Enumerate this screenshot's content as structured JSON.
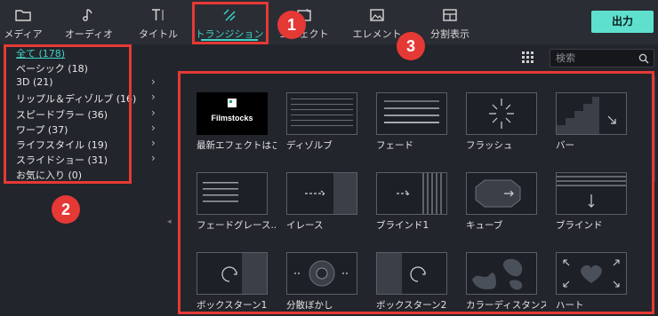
{
  "toolbar": {
    "tabs": [
      {
        "label": "メディア",
        "icon": "folder-icon"
      },
      {
        "label": "オーディオ",
        "icon": "music-note-icon"
      },
      {
        "label": "タイトル",
        "icon": "title-text-icon"
      },
      {
        "label": "トランジション",
        "icon": "transition-icon",
        "active": true
      },
      {
        "label": "エフェクト",
        "icon": "effects-icon"
      },
      {
        "label": "エレメント",
        "icon": "image-element-icon"
      },
      {
        "label": "分割表示",
        "icon": "split-screen-icon"
      }
    ],
    "export_label": "出力"
  },
  "sidebar": {
    "categories": [
      {
        "label": "全て (178)",
        "selected": true
      },
      {
        "label": "ベーシック (18)"
      },
      {
        "label": "3D (21)",
        "expandable": true
      },
      {
        "label": "リップル＆ディゾルブ (16)",
        "expandable": true
      },
      {
        "label": "スピードブラー (36)",
        "expandable": true
      },
      {
        "label": "ワープ (37)",
        "expandable": true
      },
      {
        "label": "ライフスタイル (19)",
        "expandable": true
      },
      {
        "label": "スライドショー (31)",
        "expandable": true
      },
      {
        "label": "お気に入り (0)"
      }
    ]
  },
  "search": {
    "placeholder": "検索"
  },
  "transitions": [
    {
      "label": "最新エフェクトはこ",
      "logo_text": "Filmstocks"
    },
    {
      "label": "ディゾルブ"
    },
    {
      "label": "フェード"
    },
    {
      "label": "フラッシュ"
    },
    {
      "label": "バー"
    },
    {
      "label": "フェードグレース..."
    },
    {
      "label": "イレース"
    },
    {
      "label": "ブラインド1"
    },
    {
      "label": "キューブ"
    },
    {
      "label": "ブラインド"
    },
    {
      "label": "ボックスターン1"
    },
    {
      "label": "分散ぼかし"
    },
    {
      "label": "ボックスターン2"
    },
    {
      "label": "カラーディスタンス"
    },
    {
      "label": "ハート"
    }
  ],
  "annotations": [
    {
      "number": "1"
    },
    {
      "number": "2"
    },
    {
      "number": "3"
    }
  ],
  "colors": {
    "accent": "#3fd3c6",
    "export_button": "#5fe0cf",
    "annotation_red": "#e53935",
    "background": "#1e2127"
  }
}
